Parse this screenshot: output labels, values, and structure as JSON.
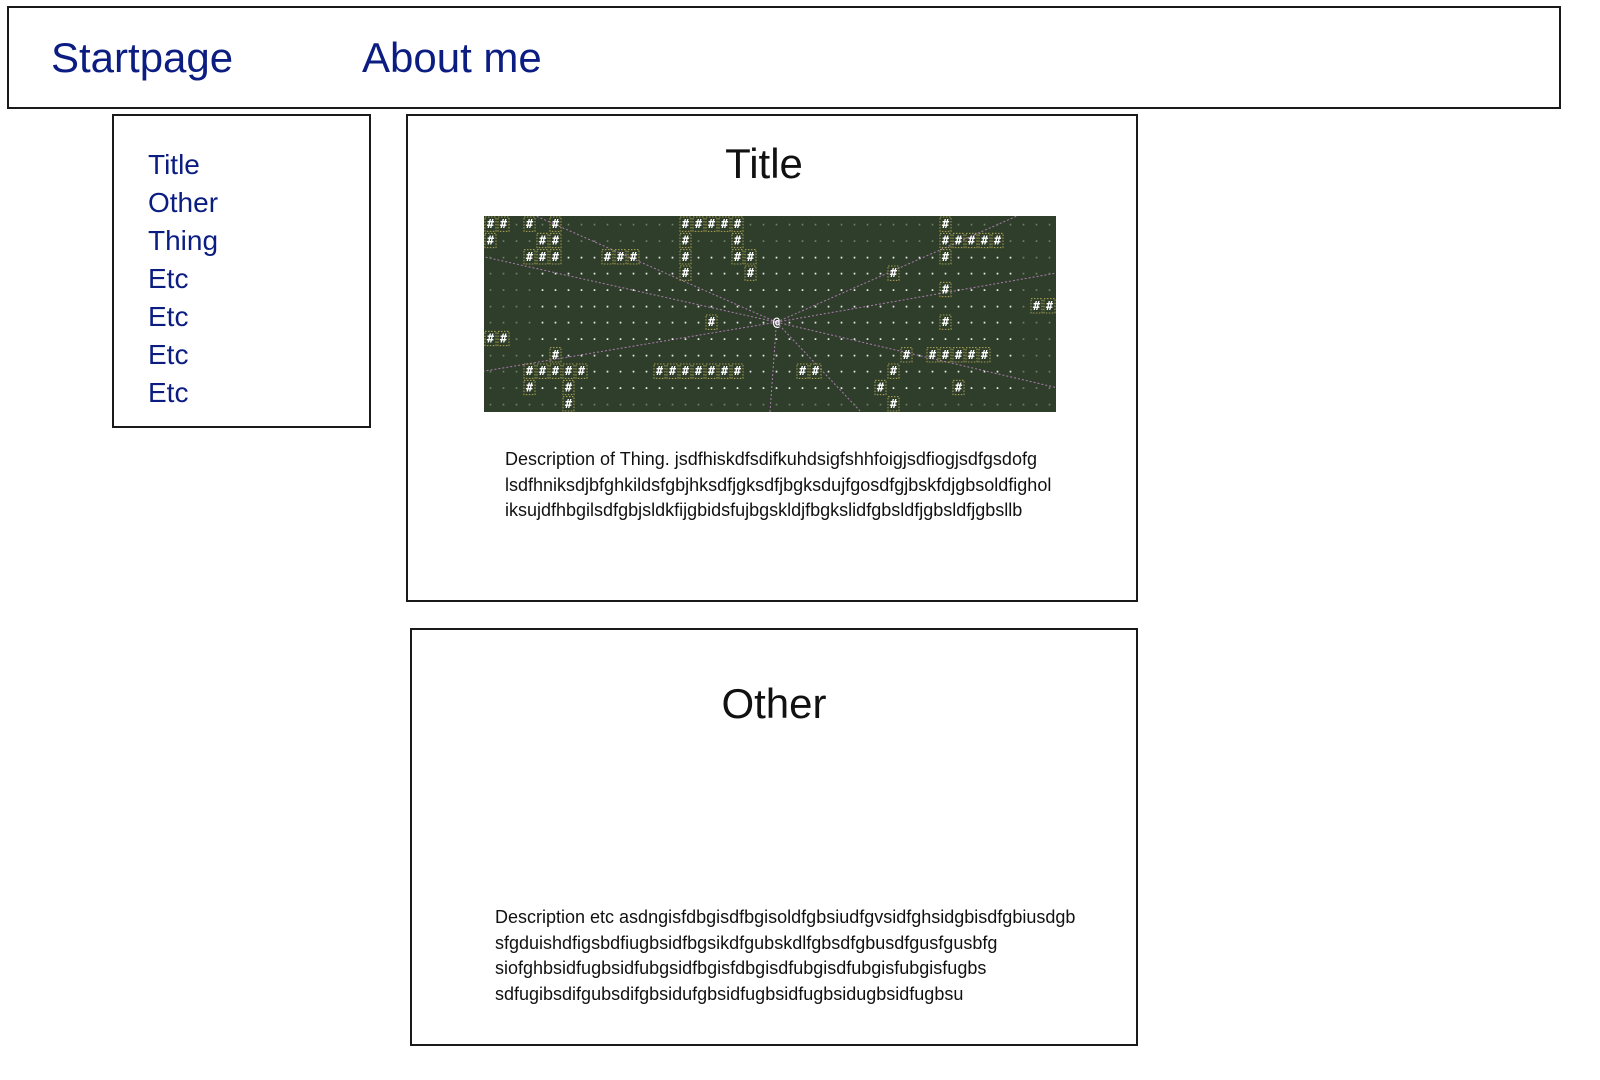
{
  "nav": {
    "startpage": "Startpage",
    "about": "About me"
  },
  "sidebar": {
    "items": [
      "Title",
      "Other",
      "Thing",
      "Etc",
      "Etc",
      "Etc",
      "Etc"
    ]
  },
  "cards": [
    {
      "title": "Title",
      "description": "Description of Thing. jsdfhiskdfsdifkuhdsigfshhfoigjsdfiogjsdfgsdofg\nlsdfhniksdjbfghkildsfgbjhksdfjgksdfjbgksdujfgosdfgjbskfdjgbsoldfighol\niksujdfhbgilsdfgbjsldkfijgbidsfujbgskldjfbgkslidfgbsldfjgbsldfjgbsllb"
    },
    {
      "title": "Other",
      "description": "Description etc asdngisfdbgisdfbgisoldfgbsiudfgvsidfghsidgbisdfgbiusdgb\nsfgduishdfigsbdfiugbsidfbgsikdfgubskdlfgbsdfgbusdfgusfgusbfg\nsiofghbsidfugbsidfubgsidfbgisfdbgisdfubgisdfubgisfubgisfugbs\nsdfugibsdifgubsdifgbsidufgbsidfugbsidfugbsidugbsidfugbsu"
    }
  ],
  "game_image": {
    "background": "#2f3e2b",
    "grid_color": "#e8e8e8",
    "dim_color": "#6e7f68",
    "wall_color": "#ffffff",
    "outline_color": "#c8b85a",
    "ray_color": "#c98bd0",
    "player_glyph": "@",
    "wall_glyph": "#",
    "floor_glyph": "·",
    "rows": [
      "##.#.#.........#####...............#........",
      "#...##.........#...#...............#####....",
      "...###...###...#...##..............#........",
      "...............#....#..........#............",
      "...................................#........",
      "..........................................##",
      ".................#....@............#........",
      "##..........................................",
      ".....#..........................#.#####.....",
      "...#####.....#######....##.....#............",
      "...#..#.......................#.....#.......",
      "......#........................#............"
    ]
  }
}
